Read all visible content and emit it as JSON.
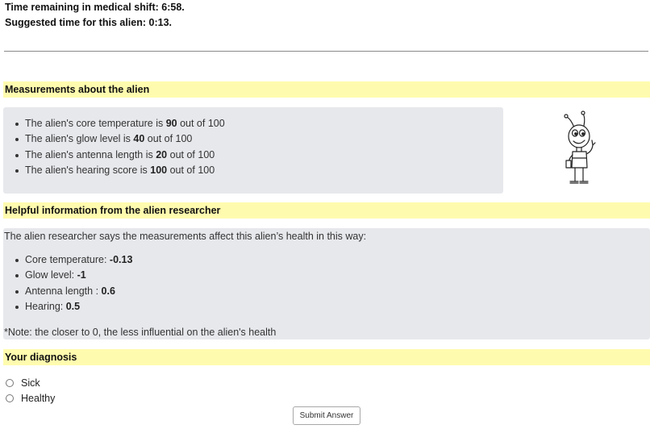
{
  "header": {
    "time_remaining": "Time remaining in medical shift: 6:58.",
    "suggested_time": "Suggested time for this alien: 0:13."
  },
  "measurements": {
    "title": "Measurements about the alien",
    "items": [
      {
        "prefix": "The alien's core temperature is ",
        "value": "90",
        "suffix": " out of 100"
      },
      {
        "prefix": "The alien's glow level is ",
        "value": "40",
        "suffix": " out of 100"
      },
      {
        "prefix": "The alien's antenna length is ",
        "value": "20",
        "suffix": " out of 100"
      },
      {
        "prefix": "The alien's hearing score is ",
        "value": "100",
        "suffix": " out of 100"
      }
    ],
    "image_icon": "alien-cartoon-icon"
  },
  "helpful_info": {
    "title": "Helpful information from the alien researcher",
    "intro": "The alien researcher says the measurements affect this alien’s health in this way:",
    "items": [
      {
        "label": "Core temperature: ",
        "value": "-0.13"
      },
      {
        "label": "Glow level: ",
        "value": "-1"
      },
      {
        "label": "Antenna length : ",
        "value": "0.6"
      },
      {
        "label": "Hearing: ",
        "value": "0.5"
      }
    ],
    "note": "*Note: the closer to 0, the less influential on the alien's health"
  },
  "diagnosis": {
    "title": "Your diagnosis",
    "options": [
      "Sick",
      "Healthy"
    ],
    "submit_label": "Submit Answer"
  },
  "colors": {
    "section_highlight": "#fffbae",
    "info_panel": "#e7e8ec"
  }
}
